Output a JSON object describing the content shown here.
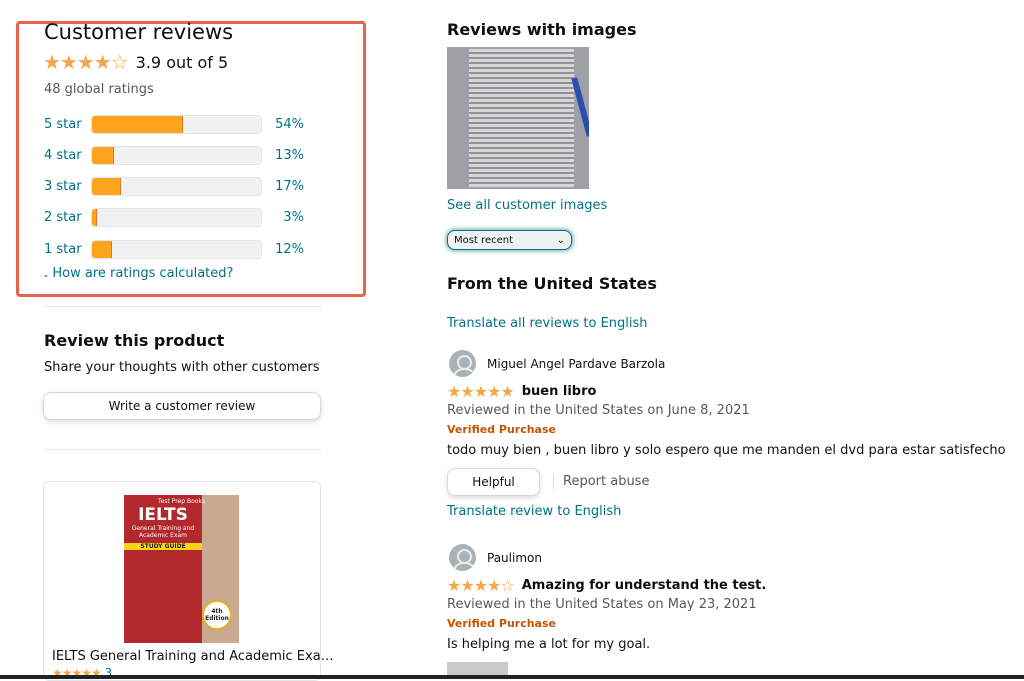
{
  "summary": {
    "title": "Customer reviews",
    "stars": "★★★★☆",
    "rating_text": "3.9 out of 5",
    "rating": 3.9,
    "global_ratings": "48 global ratings",
    "histogram": [
      {
        "label": "5 star",
        "pct": "54%",
        "value": 54
      },
      {
        "label": "4 star",
        "pct": "13%",
        "value": 13
      },
      {
        "label": "3 star",
        "pct": "17%",
        "value": 17
      },
      {
        "label": "2 star",
        "pct": "3%",
        "value": 3
      },
      {
        "label": "1 star",
        "pct": "12%",
        "value": 12
      }
    ],
    "how_calculated": "How are ratings calculated?"
  },
  "review_product": {
    "title": "Review this product",
    "subtitle": "Share your thoughts with other customers",
    "button": "Write a customer review"
  },
  "ad": {
    "cover_brand": "Test Prep Books",
    "cover_title": "IELTS",
    "cover_sub": "General Training and Academic Exam",
    "cover_guide": "STUDY GUIDE",
    "cover_edition": "4th Edition",
    "title": "IELTS General Training and Academic Exa…",
    "stars": "★★★★★",
    "count": "3"
  },
  "images": {
    "title": "Reviews with images",
    "see_all": "See all customer images"
  },
  "sort": {
    "selected": "Most recent"
  },
  "us": {
    "title": "From the United States",
    "translate_all": "Translate all reviews to English"
  },
  "reviews": [
    {
      "author": "Miguel Angel Pardave Barzola",
      "stars": "★★★★★",
      "rating": 5,
      "title": "buen libro",
      "meta": "Reviewed in the United States on June 8, 2021",
      "verified": "Verified Purchase",
      "body": "todo muy bien , buen libro y solo espero que me manden el dvd para estar satisfecho",
      "helpful": "Helpful",
      "report": "Report abuse",
      "translate": "Translate review to English"
    },
    {
      "author": "Paulimon",
      "stars": "★★★★☆",
      "rating": 4,
      "title": "Amazing for understand the test.",
      "meta": "Reviewed in the United States on May 23, 2021",
      "verified": "Verified Purchase",
      "body": "Is helping me a lot for my goal."
    }
  ]
}
